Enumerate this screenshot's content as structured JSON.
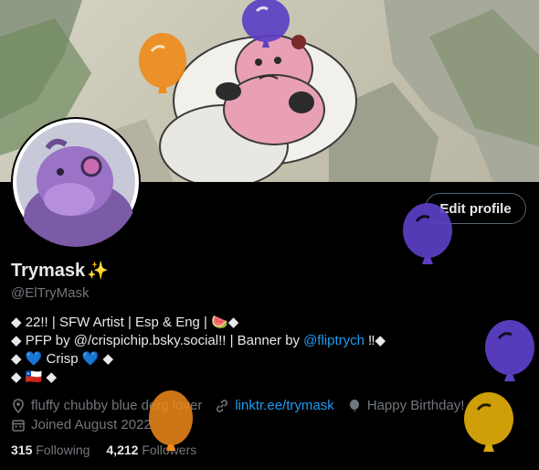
{
  "profile": {
    "display_name": "Trymask",
    "name_emoji": "✨",
    "handle": "@ElTryMask",
    "edit_label": "Edit profile"
  },
  "bio": {
    "line1": "◆ 22!! | SFW Artist | Esp & Eng | 🍉◆",
    "line2_prefix": "◆ PFP by @/crispichip.bsky.social!! | Banner by ",
    "line2_link": "@fliptrych",
    "line2_suffix": " ‼◆",
    "line3": "◆ 💙 Crisp 💙 ◆",
    "line4": "◆ 🇨🇱 ◆"
  },
  "meta": {
    "location": "fluffy chubby blue derg lover",
    "website": "linktr.ee/trymask",
    "birthday": "Happy Birthday!",
    "joined": "Joined August 2022"
  },
  "stats": {
    "following_count": "315",
    "following_label": "Following",
    "followers_count": "4,212",
    "followers_label": "Followers"
  },
  "icons": [
    "location-icon",
    "link-icon",
    "balloon-icon",
    "calendar-icon"
  ],
  "colors": {
    "background": "#000000",
    "text": "#e7e9ea",
    "secondary": "#71767b",
    "link": "#1d9bf0",
    "balloon_purple": "#5b3fc4",
    "balloon_orange": "#f08a1a",
    "balloon_gold": "#d9a80a"
  }
}
